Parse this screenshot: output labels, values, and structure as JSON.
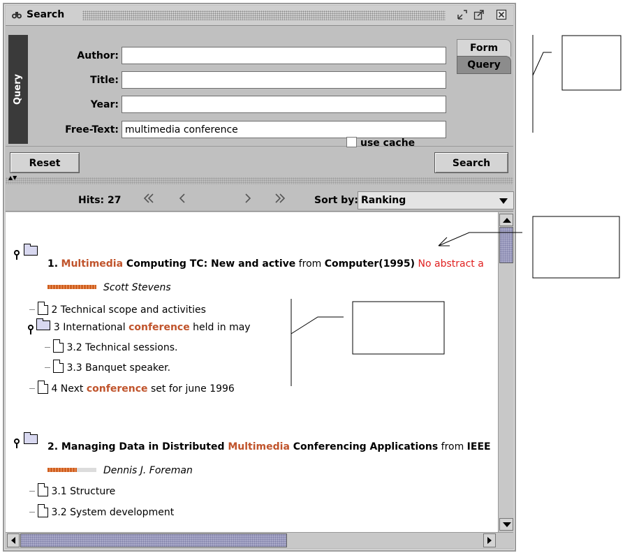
{
  "window": {
    "title": "Search"
  },
  "query_panel": {
    "side_tab": "Query",
    "fields": [
      {
        "label": "Author:",
        "value": ""
      },
      {
        "label": "Title:",
        "value": ""
      },
      {
        "label": "Year:",
        "value": ""
      },
      {
        "label": "Free-Text:",
        "value": "multimedia conference"
      }
    ],
    "tabs": [
      "Form",
      "Query"
    ],
    "reset_label": "Reset",
    "cache_label": "use cache",
    "search_label": "Search"
  },
  "results_bar": {
    "hits": "Hits: 27",
    "first": "≪",
    "prev": "<",
    "next": ">",
    "last": "≫",
    "sort_label": "Sort by:",
    "sort_value": "Ranking"
  },
  "results": [
    {
      "number": "1.",
      "title_highlight": "Multimedia",
      "title_rest": " Computing TC: New and active",
      "from_word": " from ",
      "source": "Computer(1995)",
      "note": " No abstract a",
      "author": "Scott Stevens",
      "rank_fraction": 1.0,
      "children": [
        {
          "text_before": "2 Technical scope and activities",
          "highlight": "",
          "text_after": ""
        },
        {
          "text_before": "3 International ",
          "highlight": "conference",
          "text_after": " held in may"
        },
        {
          "text_before": "3.2 Technical sessions.",
          "highlight": "",
          "text_after": ""
        },
        {
          "text_before": "3.3 Banquet speaker.",
          "highlight": "",
          "text_after": ""
        },
        {
          "text_before": "4 Next ",
          "highlight": "conference",
          "text_after": " set for june 1996"
        }
      ]
    },
    {
      "number": "2.",
      "title_before": " Managing Data in Distributed ",
      "title_highlight": "Multimedia",
      "title_rest": " Conferencing Applications",
      "from_word": " from ",
      "source": "IEEE",
      "author": "Dennis J. Foreman",
      "rank_fraction": 0.62,
      "children": [
        {
          "text_before": "3.1 Structure",
          "highlight": "",
          "text_after": ""
        },
        {
          "text_before": "3.2 System development",
          "highlight": "",
          "text_after": ""
        }
      ]
    }
  ],
  "colors": {
    "highlight": "#c0542c",
    "no_abstract": "#e02020",
    "window_bg": "#c0c0c0"
  }
}
